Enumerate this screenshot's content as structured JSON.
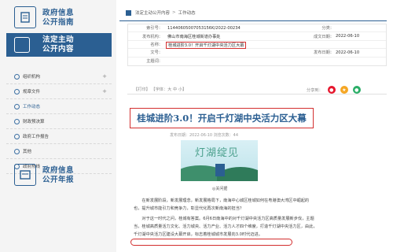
{
  "sidebar": {
    "top_banner": "政府信息\n公开指南",
    "active_banner": "法定主动\n公开内容",
    "menu": [
      {
        "label": "组织机构",
        "expandable": true
      },
      {
        "label": "规章文件",
        "expandable": true
      },
      {
        "label": "工作动态",
        "expandable": false,
        "active": true
      },
      {
        "label": "财政预决算",
        "expandable": false
      },
      {
        "label": "政府工作报告",
        "expandable": false
      },
      {
        "label": "其他",
        "expandable": false
      },
      {
        "label": "政府热线",
        "expandable": false
      }
    ],
    "bottom_banner": "政府信息\n公开年报"
  },
  "breadcrumb": {
    "parent": "法定主动公开内容",
    "sep": ">",
    "current": "工作动态"
  },
  "meta": {
    "index_label": "索引号：",
    "index_value": "11440605007053156K/2022-00234",
    "category_label": "分类：",
    "category_value": "",
    "org_label": "发布机构：",
    "org_value": "佛山市南海区桂城街道办事处",
    "created_label": "成文日期：",
    "created_value": "2022-06-10",
    "name_label": "名称：",
    "name_value": "桂城进阶3.0！开启千灯湖中央活力区大幕",
    "docno_label": "文号：",
    "docno_value": "",
    "published_label": "发布日期：",
    "published_value": "2022-06-10",
    "keywords_label": "主题词：",
    "keywords_value": ""
  },
  "toolbar": {
    "print_label": "【打印】",
    "font_label": "【字体：大 中 小】",
    "share_label": "分享到："
  },
  "article": {
    "title": "桂城进阶3.0！开启千灯湖中央活力区大幕",
    "pubinfo": "发布日期：2022-06-10  浏览次数：44",
    "photo_text": "灯湖绽见",
    "caption": "◎关问据",
    "para1": "　　在新发展阶段，新发展理念，新发展格局下，南海中心城区桂城如何在粤港澳大湾区中崛起的",
    "para1b": "也，提升城市能引力和竞争力，彰显代化再次新南海的担当？",
    "para2": "　　对于这一时代之问，桂城有答案。6月6日南海中的对千灯湖中央活力区高质量发展新步伐，主题",
    "para2b": "当，桂城高质量活力文化、活力城央、活力产业、活力人才四个维度，打造千灯湖中央活力区，由此，",
    "para3": "千灯湖中央活力区建设大幕开启，标志着桂城城市发展向3.0时代迈进。"
  },
  "colors": {
    "primary": "#2b5f92",
    "highlight": "#d32f2f",
    "sidebar_bg": "#f4f4f4"
  }
}
